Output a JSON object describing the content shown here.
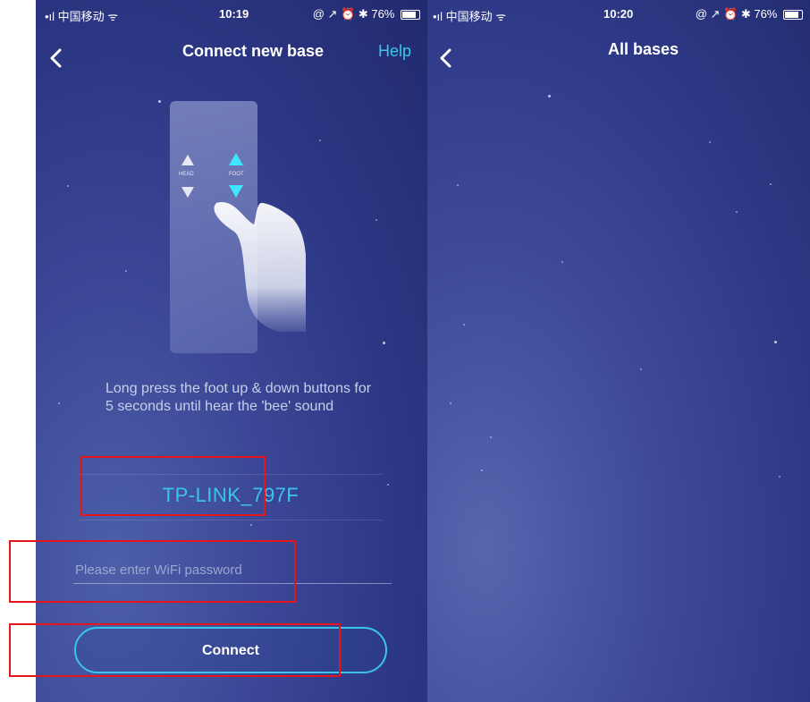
{
  "left_screen": {
    "status_bar": {
      "carrier": "•ıl 中国移动 ᯤ",
      "time": "10:19",
      "battery": "@ ↗ ⏰ ✱ 76%"
    },
    "nav": {
      "title": "Connect new base",
      "help": "Help"
    },
    "remote": {
      "head_label": "HEAD",
      "foot_label": "FOOT"
    },
    "instruction": "Long press the foot up & down buttons for 5 seconds until hear the 'bee' sound",
    "ssid": "TP-LINK_797F",
    "password_placeholder": "Please enter WiFi password",
    "connect_label": "Connect"
  },
  "right_screen": {
    "status_bar": {
      "carrier": "•ıl 中国移动 ᯤ",
      "time": "10:20",
      "battery": "@ ↗ ⏰ ✱ 76%"
    },
    "nav": {
      "title": "All bases"
    }
  },
  "colors": {
    "accent": "#3ac5ea",
    "highlight": "#e4151b"
  }
}
